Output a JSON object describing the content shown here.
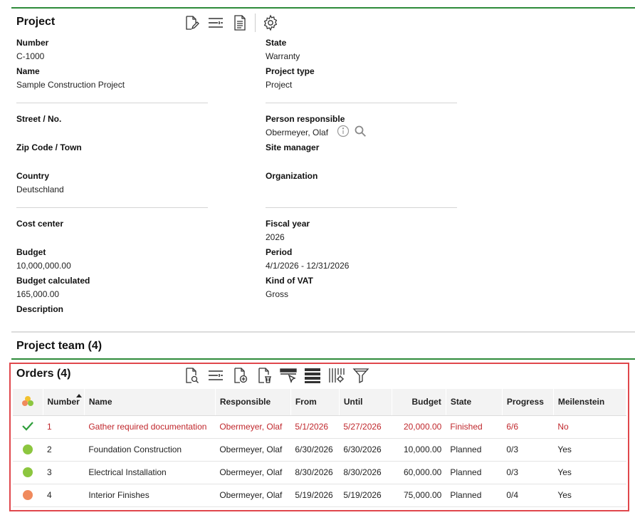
{
  "project": {
    "title": "Project",
    "toolbar": [
      "edit-document-icon",
      "filter-settings-icon",
      "report-document-icon",
      "gear-icon"
    ],
    "fields": {
      "number_label": "Number",
      "number_value": "C-1000",
      "name_label": "Name",
      "name_value": "Sample Construction Project",
      "state_label": "State",
      "state_value": "Warranty",
      "project_type_label": "Project type",
      "project_type_value": "Project",
      "street_label": "Street / No.",
      "zip_label": "Zip Code / Town",
      "country_label": "Country",
      "country_value": "Deutschland",
      "person_responsible_label": "Person responsible",
      "person_responsible_value": "Obermeyer, Olaf",
      "site_manager_label": "Site manager",
      "organization_label": "Organization",
      "cost_center_label": "Cost center",
      "budget_label": "Budget",
      "budget_value": "10,000,000.00",
      "budget_calc_label": "Budget calculated",
      "budget_calc_value": "165,000.00",
      "description_label": "Description",
      "fiscal_year_label": "Fiscal year",
      "fiscal_year_value": "2026",
      "period_label": "Period",
      "period_value": "4/1/2026 - 12/31/2026",
      "vat_label": "Kind of VAT",
      "vat_value": "Gross"
    }
  },
  "project_team": {
    "title": "Project team (4)"
  },
  "orders": {
    "title": "Orders (4)",
    "toolbar": [
      "search-document-icon",
      "filter-settings-icon",
      "add-document-icon",
      "delete-document-icon",
      "select-row-icon",
      "rows-icon",
      "column-settings-icon",
      "funnel-icon"
    ],
    "columns": [
      "",
      "Number",
      "Name",
      "Responsible",
      "From",
      "Until",
      "Budget",
      "State",
      "Progress",
      "Meilenstein"
    ],
    "rows": [
      {
        "status": "check",
        "color": "#2e9e3a",
        "number": "1",
        "name": "Gather required documentation",
        "responsible": "Obermeyer, Olaf",
        "from": "5/1/2026",
        "until": "5/27/2026",
        "budget": "20,000.00",
        "state": "Finished",
        "progress": "6/6",
        "milestone": "No",
        "highlight": true
      },
      {
        "status": "dot",
        "color": "#8cc63f",
        "number": "2",
        "name": "Foundation Construction",
        "responsible": "Obermeyer, Olaf",
        "from": "6/30/2026",
        "until": "6/30/2026",
        "budget": "10,000.00",
        "state": "Planned",
        "progress": "0/3",
        "milestone": "Yes",
        "highlight": false
      },
      {
        "status": "dot",
        "color": "#8cc63f",
        "number": "3",
        "name": "Electrical Installation",
        "responsible": "Obermeyer, Olaf",
        "from": "8/30/2026",
        "until": "8/30/2026",
        "budget": "60,000.00",
        "state": "Planned",
        "progress": "0/3",
        "milestone": "Yes",
        "highlight": false
      },
      {
        "status": "dot",
        "color": "#f08a5d",
        "number": "4",
        "name": "Interior Finishes",
        "responsible": "Obermeyer, Olaf",
        "from": "5/19/2026",
        "until": "5/19/2026",
        "budget": "75,000.00",
        "state": "Planned",
        "progress": "0/4",
        "milestone": "Yes",
        "highlight": false
      }
    ]
  },
  "colors": {
    "accent_green": "#2e8b3a",
    "highlight_red": "#c0282d",
    "frame_red": "#e0474c"
  }
}
